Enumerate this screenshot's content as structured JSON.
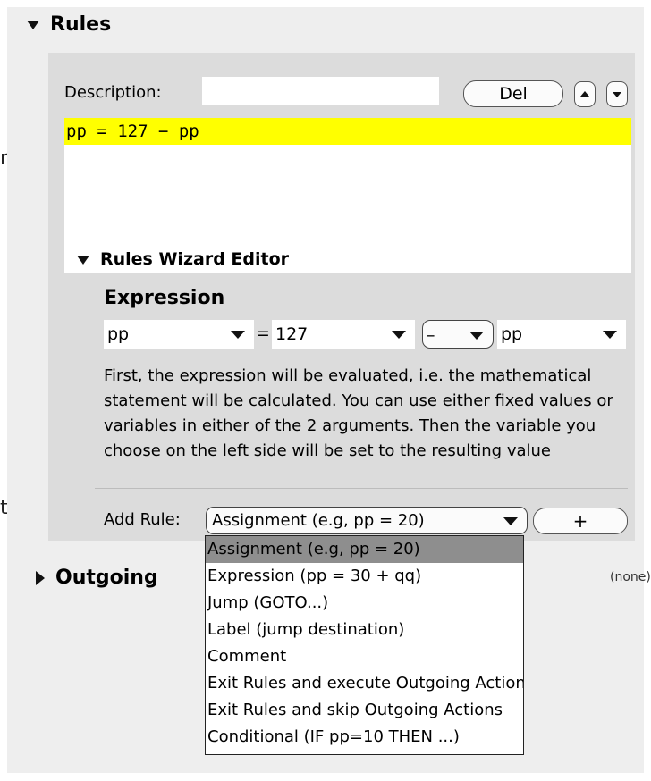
{
  "edge_chars": [
    "r",
    "t"
  ],
  "rules_section": {
    "title": "Rules"
  },
  "description": {
    "label": "Description:",
    "value": ""
  },
  "buttons": {
    "delete": "Del",
    "add": "+"
  },
  "rules_list": [
    "pp  =  127  −  pp"
  ],
  "wizard": {
    "title": "Rules Wizard Editor",
    "expression_title": "Expression",
    "target_variable": "pp",
    "equals": "=",
    "value": "127",
    "operator": "–",
    "operand_variable": "pp",
    "explanation": "First, the expression will be evaluated, i.e. the mathematical statement will be calculated. You can use either fixed values or variables in either of the 2 arguments. Then the variable you choose on the left side will be set to the resulting value"
  },
  "add_rule": {
    "label": "Add Rule:",
    "selected": "Assignment (e.g, pp = 20)",
    "options": [
      "Assignment (e.g, pp = 20)",
      "Expression (pp = 30 + qq)",
      "Jump (GOTO...)",
      "Label (jump destination)",
      "Comment",
      "Exit Rules and execute Outgoing Actions",
      "Exit Rules and skip Outgoing Actions",
      "Conditional (IF pp=10 THEN ...)"
    ]
  },
  "outgoing_section": {
    "title": "Outgoing",
    "status": "(none)"
  },
  "colors": {
    "highlight": "#ffff00",
    "panel": "#eeeeee",
    "inner_panel": "#dcdcdc",
    "menu_selected": "#8e8e8e"
  }
}
